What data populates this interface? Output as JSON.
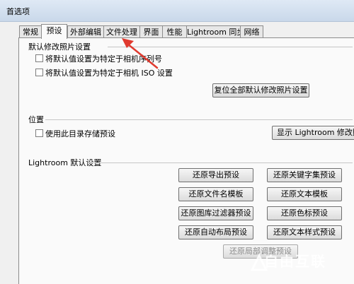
{
  "window": {
    "title": "首选项"
  },
  "tabs": [
    {
      "label": "常规"
    },
    {
      "label": "预设"
    },
    {
      "label": "外部编辑"
    },
    {
      "label": "文件处理"
    },
    {
      "label": "界面"
    },
    {
      "label": "性能"
    },
    {
      "label": "Lightroom 同步"
    },
    {
      "label": "网络"
    }
  ],
  "active_tab": "预设",
  "develop_defaults": {
    "heading": "默认修改照片设置",
    "checkbox_serial": "将默认值设置为特定于相机序列号",
    "checkbox_iso": "将默认值设置为特定于相机 ISO 设置",
    "reset_button": "复位全部默认修改照片设置"
  },
  "location": {
    "heading": "位置",
    "checkbox_store": "使用此目录存储预设",
    "show_button": "显示 Lightroom 修改照片预设"
  },
  "lightroom_defaults": {
    "heading": "Lightroom 默认设置",
    "buttons": [
      "还原导出预设",
      "还原关键字集预设",
      "还原文件名模板",
      "还原文本模板",
      "还原图库过滤器预设",
      "还原色标预设",
      "还原自动布局预设",
      "还原文本样式预设",
      "还原局部调整预设"
    ]
  },
  "annotation": {
    "color": "#e03a2f"
  },
  "watermark": {
    "text": "自由互联"
  }
}
